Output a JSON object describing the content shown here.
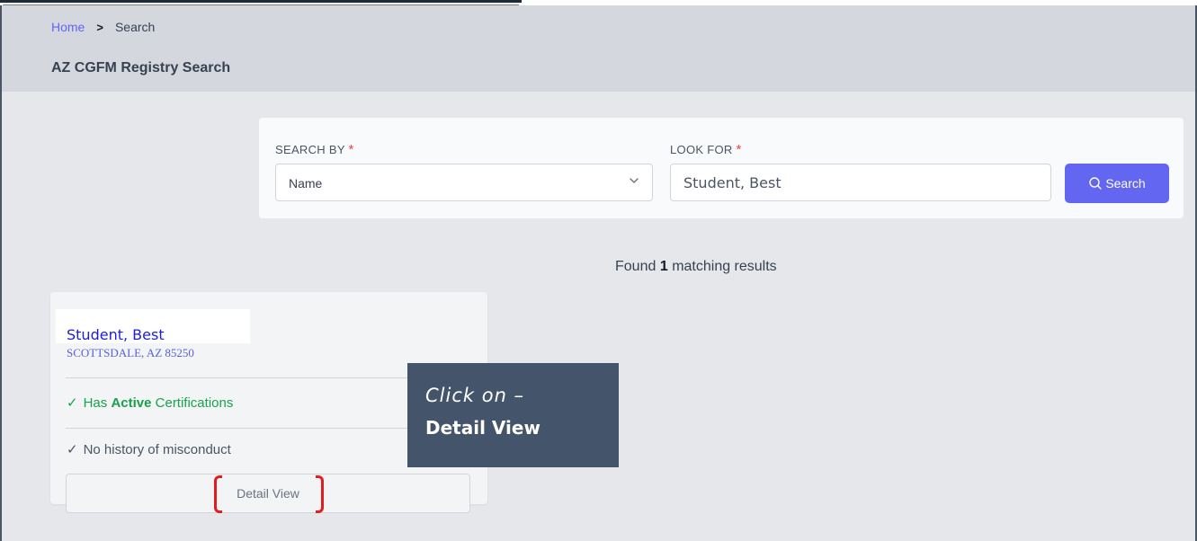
{
  "breadcrumb": {
    "home": "Home",
    "separator": ">",
    "current": "Search"
  },
  "page": {
    "title": "AZ CGFM Registry Search"
  },
  "search": {
    "search_by_label": "SEARCH BY",
    "look_for_label": "LOOK FOR",
    "required_marker": "*",
    "search_by_value": "Name",
    "look_for_value": "Student, Best",
    "button_label": "Search"
  },
  "results": {
    "prefix": "Found",
    "count": "1",
    "suffix": "matching results"
  },
  "card": {
    "name": "Student, Best",
    "location": "SCOTTSDALE, AZ 85250",
    "check_symbol": "✓",
    "cert_prefix": "Has",
    "cert_status": "Active",
    "cert_suffix": "Certifications",
    "conduct": "No history of misconduct",
    "detail_button": "Detail View"
  },
  "annotation": {
    "line1": "Click on –",
    "line2": "Detail View"
  },
  "colors": {
    "accent": "#6366f1",
    "success": "#16a34a",
    "required": "#ef4444",
    "callout_bg": "#44546a",
    "highlight_bracket": "#e11d1d"
  },
  "icons": {
    "search_button": "search-icon",
    "select": "chevron-down-icon"
  }
}
